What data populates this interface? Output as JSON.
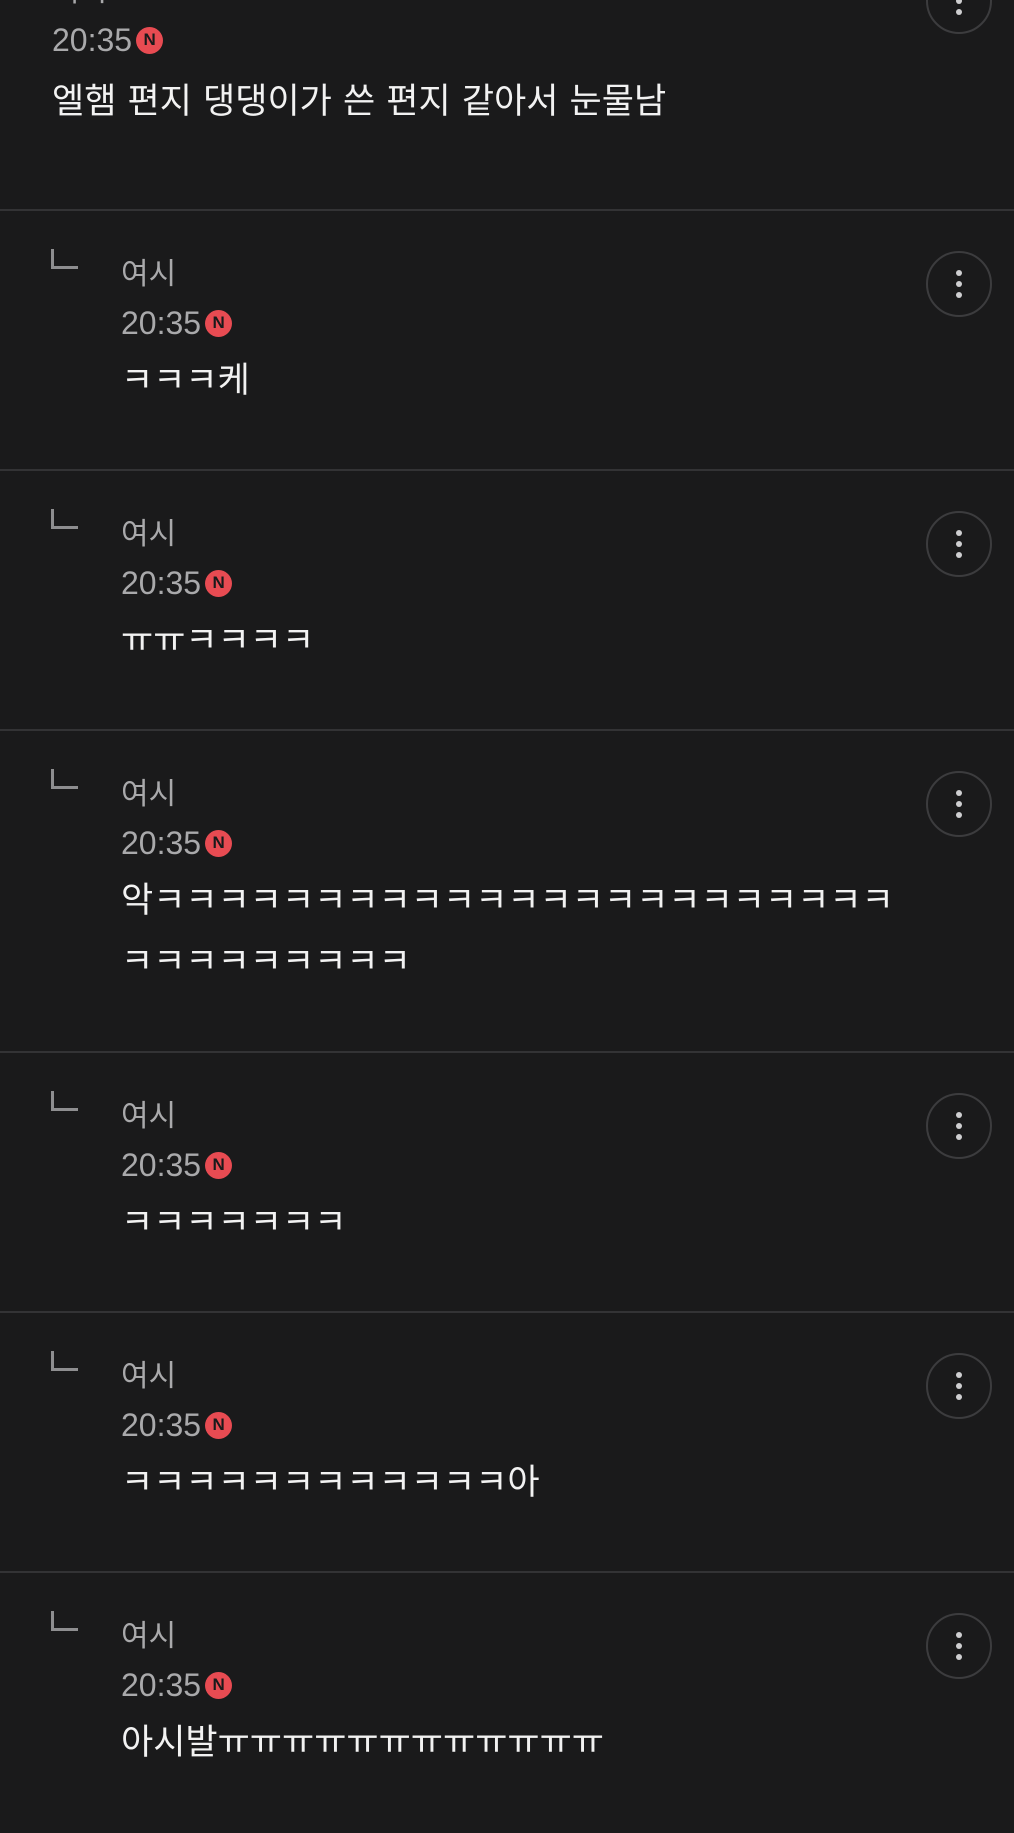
{
  "comments": [
    {
      "author": "여시",
      "time": "20:35",
      "badge": "N",
      "text": "엘햄 편지 댕댕이가 쓴 편지 같아서 눈물남",
      "reply": false
    },
    {
      "author": "여시",
      "time": "20:35",
      "badge": "N",
      "text": "ㅋㅋㅋ케",
      "reply": true
    },
    {
      "author": "여시",
      "time": "20:35",
      "badge": "N",
      "text": "ㅠㅠㅋㅋㅋㅋ",
      "reply": true
    },
    {
      "author": "여시",
      "time": "20:35",
      "badge": "N",
      "text": "악ㅋㅋㅋㅋㅋㅋㅋㅋㅋㅋㅋㅋㅋㅋㅋㅋㅋㅋㅋㅋㅋㅋㅋㅋㅋㅋㅋㅋㅋㅋㅋㅋ",
      "reply": true
    },
    {
      "author": "여시",
      "time": "20:35",
      "badge": "N",
      "text": "ㅋㅋㅋㅋㅋㅋㅋ",
      "reply": true
    },
    {
      "author": "여시",
      "time": "20:35",
      "badge": "N",
      "text": "ㅋㅋㅋㅋㅋㅋㅋㅋㅋㅋㅋㅋ아",
      "reply": true
    },
    {
      "author": "여시",
      "time": "20:35",
      "badge": "N",
      "text": "아시발ㅠㅠㅠㅠㅠㅠㅠㅠㅠㅠㅠㅠ",
      "reply": true
    }
  ],
  "icons": {
    "more": "more-vertical-icon",
    "reply": "reply-arrow-icon",
    "new": "new-badge-icon"
  },
  "colors": {
    "background": "#1a1a1b",
    "divider": "#333335",
    "meta_text": "#a9a9ab",
    "body_text": "#f2f2f2",
    "new_badge": "#e84b52"
  }
}
